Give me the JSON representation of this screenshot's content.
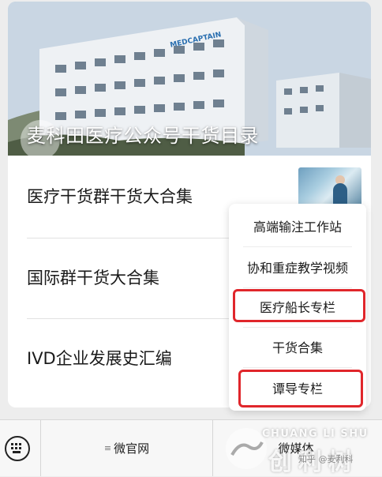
{
  "banner": {
    "title": "麦科田医疗公众号干货目录",
    "building_logo": "MEDCAPTAIN"
  },
  "articles": [
    {
      "label": "医疗干货群干货大合集"
    },
    {
      "label": "国际群干货大合集"
    },
    {
      "label": "IVD企业发展史汇编"
    }
  ],
  "popup": {
    "items": [
      {
        "label": "高端输注工作站",
        "highlighted": false
      },
      {
        "label": "协和重症教学视频",
        "highlighted": false
      },
      {
        "label": "医疗船长专栏",
        "highlighted": true
      },
      {
        "label": "干货合集",
        "highlighted": false
      },
      {
        "label": "谭导专栏",
        "highlighted": true
      }
    ]
  },
  "bottom_bar": {
    "menus": [
      {
        "label": "微官网"
      },
      {
        "label": "微媒体"
      }
    ]
  },
  "watermark": {
    "latin": "CHUANG LI SHU",
    "big": "创利树",
    "small": "知乎 @麦利科"
  },
  "colors": {
    "highlight": "#e0262b",
    "background": "#ededed"
  },
  "icons": [
    "back-arrow-icon",
    "keyboard-icon",
    "menu-lines-icon",
    "watermark-logo-icon"
  ]
}
